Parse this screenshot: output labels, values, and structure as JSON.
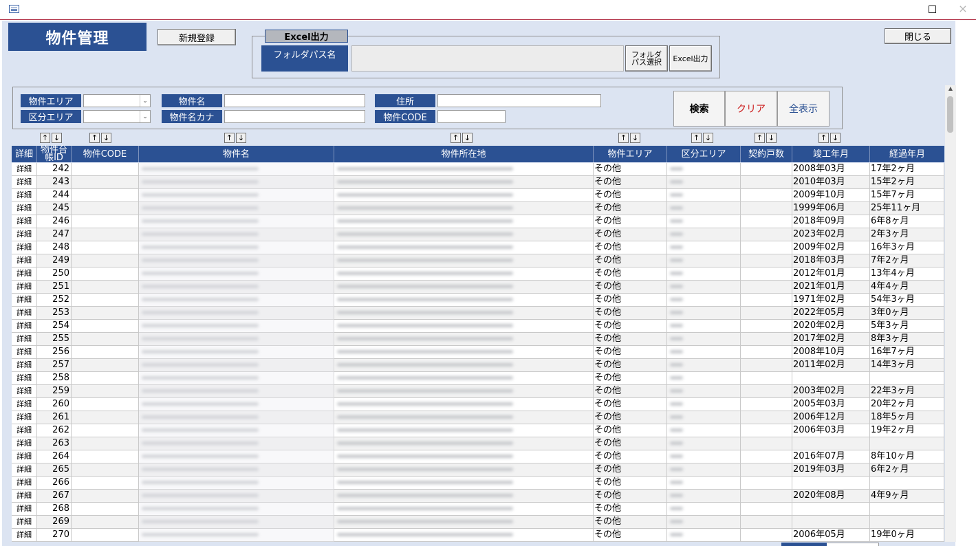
{
  "window": {
    "close_glyph": "×"
  },
  "header": {
    "title": "物件管理",
    "new_button": "新規登録",
    "close_button": "閉じる"
  },
  "excel": {
    "legend": "Excel出力",
    "folder_label": "フォルダパス名",
    "folder_value": "",
    "select_button_line1": "フォルダ",
    "select_button_line2": "パス選択",
    "export_button": "Excel出力"
  },
  "search": {
    "area_label": "物件エリア",
    "area_value": "",
    "kubun_label": "区分エリア",
    "kubun_value": "",
    "name_label": "物件名",
    "name_value": "",
    "kana_label": "物件名カナ",
    "kana_value": "",
    "address_label": "住所",
    "address_value": "",
    "code_label": "物件CODE",
    "code_value": "",
    "search_button": "検索",
    "clear_button": "クリア",
    "showall_button": "全表示"
  },
  "sort": {
    "up": "↑",
    "down": "↓"
  },
  "columns": {
    "detail": "詳細",
    "ledger_id_1": "物件台",
    "ledger_id_2": "帳ID",
    "code": "物件CODE",
    "name": "物件名",
    "address": "物件所在地",
    "area": "物件エリア",
    "kubun": "区分エリア",
    "units": "契約戸数",
    "built": "竣工年月",
    "age": "経過年月"
  },
  "rows": [
    {
      "detail": "詳細",
      "id": "242",
      "area": "その他",
      "built": "2008年03月",
      "age": "17年2ヶ月"
    },
    {
      "detail": "詳細",
      "id": "243",
      "area": "その他",
      "built": "2010年03月",
      "age": "15年2ヶ月"
    },
    {
      "detail": "詳細",
      "id": "244",
      "area": "その他",
      "built": "2009年10月",
      "age": "15年7ヶ月"
    },
    {
      "detail": "詳細",
      "id": "245",
      "area": "その他",
      "built": "1999年06月",
      "age": "25年11ヶ月"
    },
    {
      "detail": "詳細",
      "id": "246",
      "area": "その他",
      "built": "2018年09月",
      "age": "6年8ヶ月"
    },
    {
      "detail": "詳細",
      "id": "247",
      "area": "その他",
      "built": "2023年02月",
      "age": "2年3ヶ月"
    },
    {
      "detail": "詳細",
      "id": "248",
      "area": "その他",
      "built": "2009年02月",
      "age": "16年3ヶ月"
    },
    {
      "detail": "詳細",
      "id": "249",
      "area": "その他",
      "built": "2018年03月",
      "age": "7年2ヶ月"
    },
    {
      "detail": "詳細",
      "id": "250",
      "area": "その他",
      "built": "2012年01月",
      "age": "13年4ヶ月"
    },
    {
      "detail": "詳細",
      "id": "251",
      "area": "その他",
      "built": "2021年01月",
      "age": "4年4ヶ月"
    },
    {
      "detail": "詳細",
      "id": "252",
      "area": "その他",
      "built": "1971年02月",
      "age": "54年3ヶ月"
    },
    {
      "detail": "詳細",
      "id": "253",
      "area": "その他",
      "built": "2022年05月",
      "age": "3年0ヶ月"
    },
    {
      "detail": "詳細",
      "id": "254",
      "area": "その他",
      "built": "2020年02月",
      "age": "5年3ヶ月"
    },
    {
      "detail": "詳細",
      "id": "255",
      "area": "その他",
      "built": "2017年02月",
      "age": "8年3ヶ月"
    },
    {
      "detail": "詳細",
      "id": "256",
      "area": "その他",
      "built": "2008年10月",
      "age": "16年7ヶ月"
    },
    {
      "detail": "詳細",
      "id": "257",
      "area": "その他",
      "built": "2011年02月",
      "age": "14年3ヶ月"
    },
    {
      "detail": "詳細",
      "id": "258",
      "area": "その他",
      "built": "",
      "age": ""
    },
    {
      "detail": "詳細",
      "id": "259",
      "area": "その他",
      "built": "2003年02月",
      "age": "22年3ヶ月"
    },
    {
      "detail": "詳細",
      "id": "260",
      "area": "その他",
      "built": "2005年03月",
      "age": "20年2ヶ月"
    },
    {
      "detail": "詳細",
      "id": "261",
      "area": "その他",
      "built": "2006年12月",
      "age": "18年5ヶ月"
    },
    {
      "detail": "詳細",
      "id": "262",
      "area": "その他",
      "built": "2006年03月",
      "age": "19年2ヶ月"
    },
    {
      "detail": "詳細",
      "id": "263",
      "area": "その他",
      "built": "",
      "age": ""
    },
    {
      "detail": "詳細",
      "id": "264",
      "area": "その他",
      "built": "2016年07月",
      "age": "8年10ヶ月"
    },
    {
      "detail": "詳細",
      "id": "265",
      "area": "その他",
      "built": "2019年03月",
      "age": "6年2ヶ月"
    },
    {
      "detail": "詳細",
      "id": "266",
      "area": "その他",
      "built": "",
      "age": ""
    },
    {
      "detail": "詳細",
      "id": "267",
      "area": "その他",
      "built": "2020年08月",
      "age": "4年9ヶ月"
    },
    {
      "detail": "詳細",
      "id": "268",
      "area": "その他",
      "built": "",
      "age": ""
    },
    {
      "detail": "詳細",
      "id": "269",
      "area": "その他",
      "built": "",
      "age": ""
    },
    {
      "detail": "詳細",
      "id": "270",
      "area": "その他",
      "built": "2006年05月",
      "age": "19年0ヶ月"
    }
  ]
}
